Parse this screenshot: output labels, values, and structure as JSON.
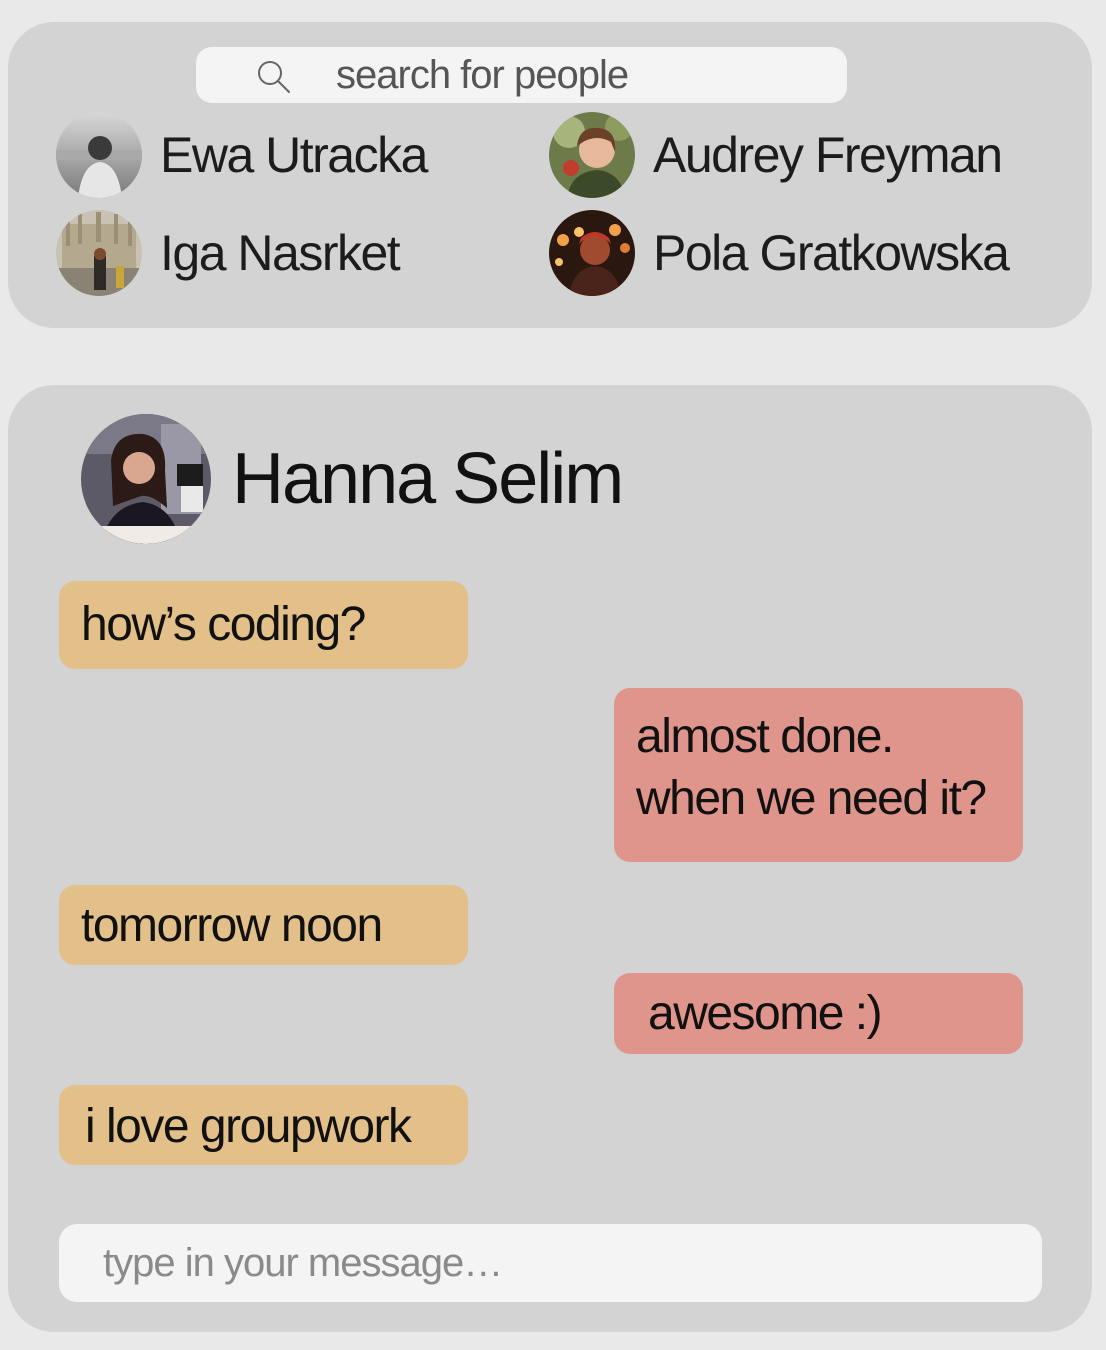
{
  "search": {
    "placeholder": "search for people",
    "icon": "search-icon"
  },
  "contacts": [
    {
      "name": "Ewa Utracka"
    },
    {
      "name": "Audrey Freyman"
    },
    {
      "name": "Iga Nasrket"
    },
    {
      "name": "Pola Gratkowska"
    }
  ],
  "chat": {
    "contact_name": "Hanna Selim",
    "messages": [
      {
        "direction": "incoming",
        "text": "how’s coding?"
      },
      {
        "direction": "outgoing",
        "text": "almost done.\nwhen we need it?"
      },
      {
        "direction": "incoming",
        "text": "tomorrow noon"
      },
      {
        "direction": "outgoing",
        "text": "awesome :)"
      },
      {
        "direction": "incoming",
        "text": "i love groupwork"
      }
    ],
    "composer_placeholder": "type in your message…"
  },
  "colors": {
    "incoming_bubble": "#e3bf8a",
    "outgoing_bubble": "#e0958c",
    "panel": "#d3d3d3",
    "background": "#e9e9e9"
  }
}
